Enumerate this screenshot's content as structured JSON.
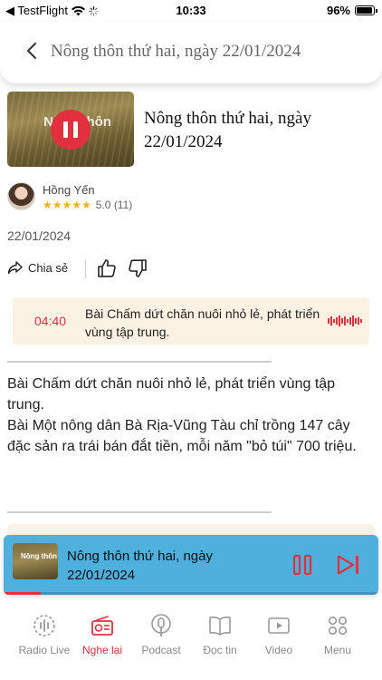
{
  "status_bar": {
    "carrier": "◀ TestFlight",
    "time": "10:33",
    "battery_text": "96%",
    "battery_level": 0.96
  },
  "header": {
    "title": "Nông thôn thứ hai, ngày 22/01/2024"
  },
  "program": {
    "title": "Nông thôn thứ hai, ngày 22/01/2024",
    "thumbnail_logo": "Nông thôn",
    "is_playing": true
  },
  "author": {
    "name": "Hồng Yến",
    "stars": "★★★★★",
    "rating_text": "5.0 (11)"
  },
  "date": "22/01/2024",
  "actions": {
    "share_label": "Chia sẻ"
  },
  "chapter": {
    "time": "04:40",
    "text": "Bài Chấm dứt chăn nuôi nhỏ lẻ, phát triển vùng tập trung."
  },
  "description": [
    "Bài Chấm dứt chăn nuôi nhỏ lẻ, phát triển vùng tập trung.",
    "Bài Một nông dân Bà Rịa-Vũng Tàu chỉ trồng 147 cây đặc sản ra trái bán đắt tiền, mỗi năm \"bỏ túi\" 700 triệu."
  ],
  "mini_player": {
    "title": "Nông thôn thứ hai, ngày 22/01/2024",
    "thumbnail_logo": "Nông thôn",
    "progress": 0.1
  },
  "tabs": [
    {
      "label": "Radio Live",
      "icon": "radio-live-icon",
      "active": false
    },
    {
      "label": "Nghe lại",
      "icon": "radio-icon",
      "active": true
    },
    {
      "label": "Podcast",
      "icon": "podcast-icon",
      "active": false
    },
    {
      "label": "Đọc tin",
      "icon": "book-icon",
      "active": false
    },
    {
      "label": "Video",
      "icon": "video-icon",
      "active": false
    },
    {
      "label": "Menu",
      "icon": "menu-icon",
      "active": false
    }
  ],
  "colors": {
    "accent": "#e2303f",
    "player_bg": "#4fb0dd",
    "chapter_bg": "#fcf2e4",
    "star": "#f2b01e"
  }
}
